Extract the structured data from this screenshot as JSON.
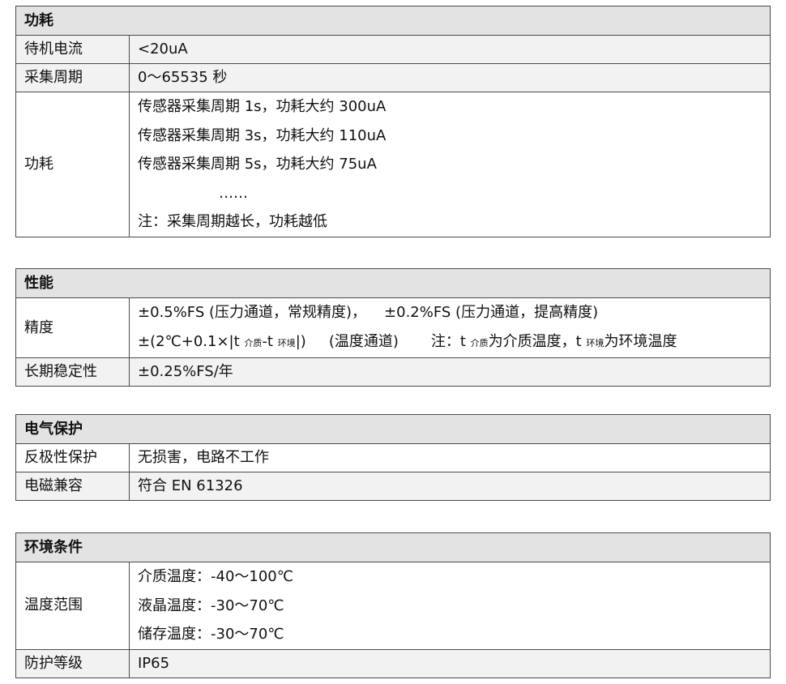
{
  "sections": {
    "power": {
      "title": "功耗",
      "rows": {
        "standby_current": {
          "label": "待机电流",
          "value": "<20uA"
        },
        "sample_period": {
          "label": "采集周期",
          "value": "0～65535 秒"
        },
        "consumption": {
          "label": "功耗",
          "lines": [
            "传感器采集周期 1s，功耗大约 300uA",
            "传感器采集周期 3s，功耗大约 110uA",
            "传感器采集周期 5s，功耗大约 75uA",
            "……",
            "注：采集周期越长，功耗越低"
          ]
        }
      }
    },
    "performance": {
      "title": "性能",
      "rows": {
        "accuracy": {
          "label": "精度",
          "line1_part1": "±0.5%FS (压力通道，常规精度)，",
          "line1_part2": "±0.2%FS (压力通道，提高精度)",
          "line2_prefix": "±(2℃+0.1×|t",
          "line2_sub_medium": "介质",
          "line2_mid": "-t",
          "line2_sub_env": "环境",
          "line2_close": "|)",
          "line2_channel": "(温度通道)",
          "note_prefix": "注：t",
          "note_sub_medium": "介质",
          "note_medium_desc": "为介质温度，t",
          "note_sub_env": "环境",
          "note_env_desc": "为环境温度"
        },
        "stability": {
          "label": "长期稳定性",
          "value": "±0.25%FS/年"
        }
      }
    },
    "protection": {
      "title": "电气保护",
      "rows": {
        "reverse_polarity": {
          "label": "反极性保护",
          "value": "无损害，电路不工作"
        },
        "emc": {
          "label": "电磁兼容",
          "value": "符合 EN 61326"
        }
      }
    },
    "environment": {
      "title": "环境条件",
      "rows": {
        "temp_range": {
          "label": "温度范围",
          "lines": [
            "介质温度：-40～100℃",
            "液晶温度：-30～70℃",
            "储存温度：-30～70℃"
          ]
        },
        "ip_rating": {
          "label": "防护等级",
          "value": "IP65"
        }
      }
    }
  }
}
